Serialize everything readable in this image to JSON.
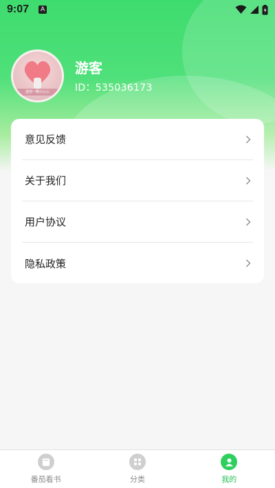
{
  "status_bar": {
    "time": "9:07",
    "notification_icon_letter": "A",
    "icons": [
      "wifi-icon",
      "signal-icon",
      "battery-icon"
    ]
  },
  "profile": {
    "name": "游客",
    "id_text": "ID：535036173",
    "avatar_caption": "送你一颗小心心"
  },
  "menu": {
    "items": [
      {
        "label": "意见反馈"
      },
      {
        "label": "关于我们"
      },
      {
        "label": "用户协议"
      },
      {
        "label": "隐私政策"
      }
    ]
  },
  "bottom_nav": {
    "items": [
      {
        "label": "番茄看书",
        "icon": "book-icon",
        "active": false
      },
      {
        "label": "分类",
        "icon": "grid-icon",
        "active": false
      },
      {
        "label": "我的",
        "icon": "user-icon",
        "active": true
      }
    ],
    "active_color": "#27c157",
    "inactive_color": "#8a8a8a"
  },
  "colors": {
    "header_green": "#3edc6e",
    "card_bg": "#ffffff",
    "page_bg": "#f6f6f6"
  }
}
